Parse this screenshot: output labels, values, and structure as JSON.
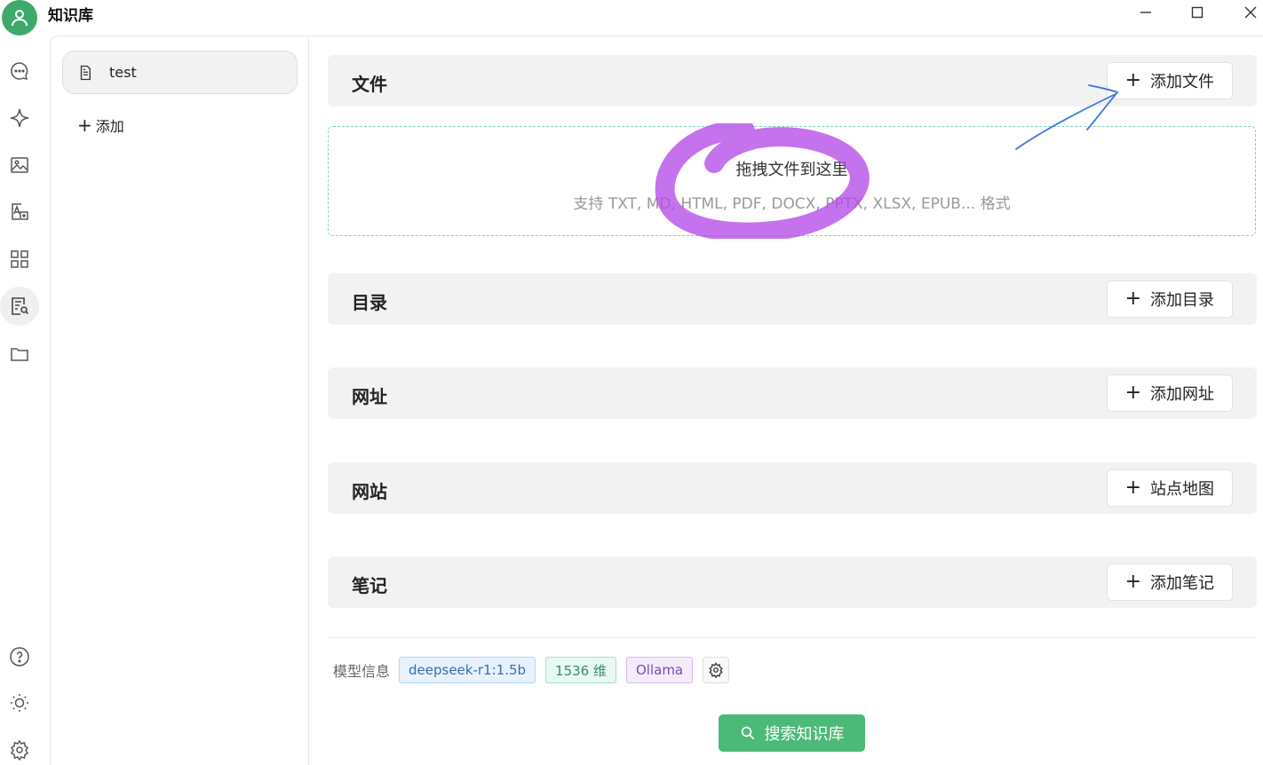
{
  "app": {
    "title": "知识库"
  },
  "window_controls": [
    "minimize",
    "maximize",
    "close"
  ],
  "rail": {
    "items": [
      {
        "icon": "chat-icon"
      },
      {
        "icon": "sparkle-icon"
      },
      {
        "icon": "image-icon"
      },
      {
        "icon": "translate-icon"
      },
      {
        "icon": "apps-grid-icon"
      },
      {
        "icon": "knowledge-search-icon",
        "active": true
      },
      {
        "icon": "folder-icon"
      }
    ],
    "bottom_items": [
      {
        "icon": "help-icon"
      },
      {
        "icon": "theme-sun-icon"
      },
      {
        "icon": "settings-gear-icon"
      }
    ]
  },
  "sidebar": {
    "kb_items": [
      {
        "name": "test"
      }
    ],
    "add_label": "添加"
  },
  "main": {
    "sections": [
      {
        "title": "文件",
        "button": "添加文件"
      },
      {
        "title": "目录",
        "button": "添加目录"
      },
      {
        "title": "网址",
        "button": "添加网址"
      },
      {
        "title": "网站",
        "button": "站点地图"
      },
      {
        "title": "笔记",
        "button": "添加笔记"
      }
    ],
    "dropzone": {
      "title": "拖拽文件到这里",
      "subtitle": "支持 TXT, MD, HTML, PDF, DOCX, PPTX, XLSX, EPUB... 格式"
    },
    "model_info": {
      "label": "模型信息",
      "model": "deepseek-r1:1.5b",
      "dimensions": "1536 维",
      "provider": "Ollama"
    },
    "search_button": "搜索知识库"
  },
  "colors": {
    "accent_green": "#4cb978",
    "highlight_purple": "#b54ae8",
    "arrow_blue": "#3a78e0"
  }
}
